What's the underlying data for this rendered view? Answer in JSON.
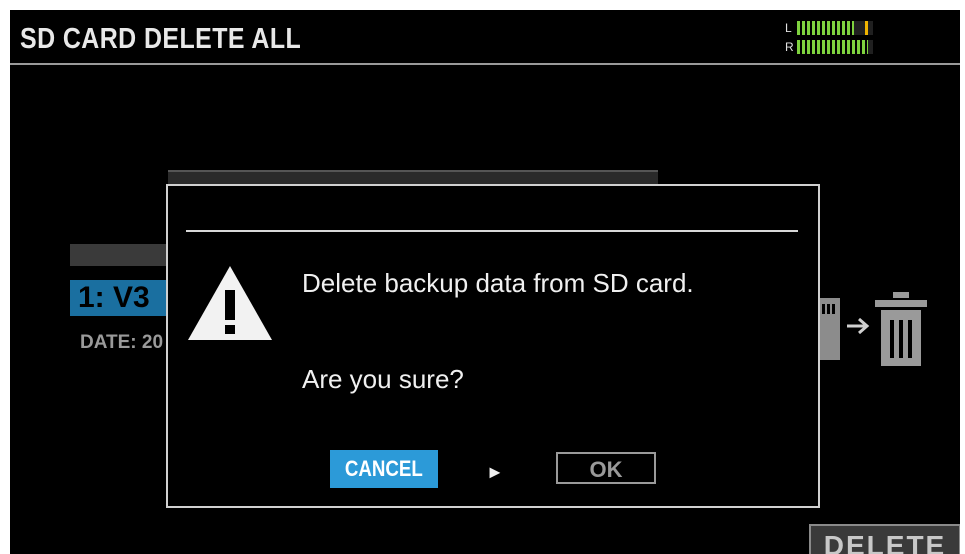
{
  "header": {
    "title": "SD CARD DELETE ALL",
    "meter": {
      "left_label": "L",
      "right_label": "R",
      "left_level": 0.75,
      "right_level": 0.93,
      "left_peak": 0.9
    }
  },
  "background": {
    "slot_label": "1: V3",
    "date_label": "DATE: 20"
  },
  "icons": [
    "sd-card-icon",
    "arrow-right-icon",
    "trash-icon",
    "warning-icon"
  ],
  "dialog": {
    "message": "Delete backup data from SD card.",
    "question": "Are you sure?",
    "cancel_label": "CANCEL",
    "ok_label": "OK",
    "selection_arrow": "►"
  },
  "footer": {
    "delete_label": "DELETE"
  },
  "colors": {
    "accent": "#2c9ad8",
    "background": "#000000",
    "meter_green": "#7fd23f",
    "meter_peak": "#f0b400"
  }
}
